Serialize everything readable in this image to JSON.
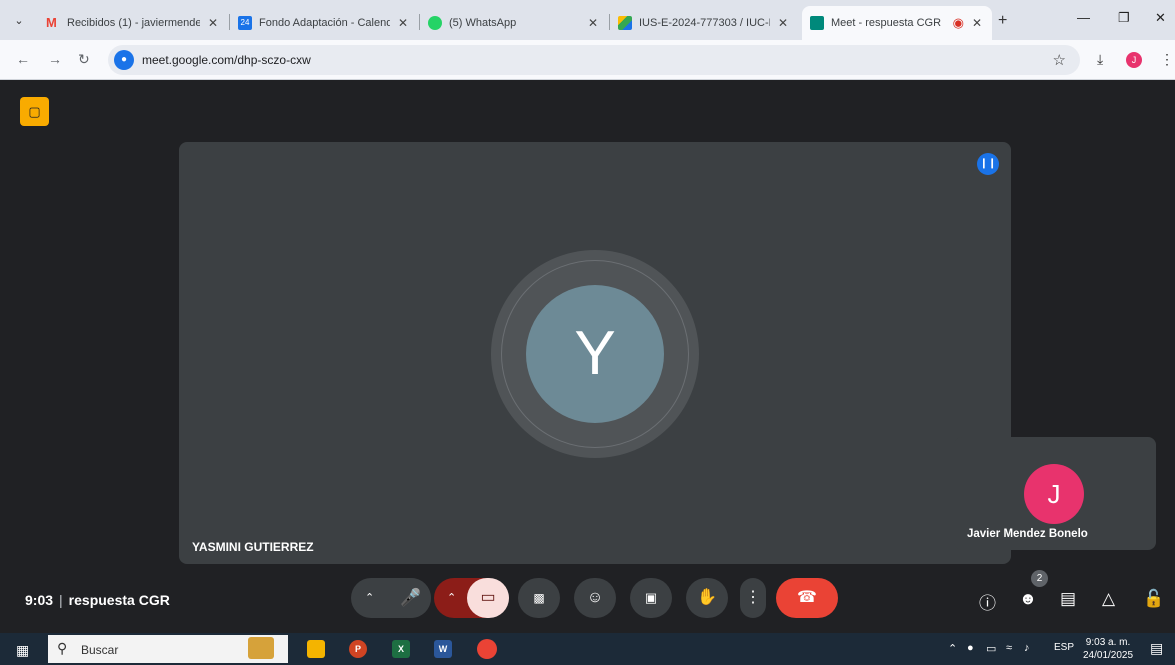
{
  "browser": {
    "tabs": [
      {
        "label": "Recibidos (1) - javiermendez",
        "favicon": "gmail-icon",
        "color": "#ea4335"
      },
      {
        "label": "Fondo Adaptación - Calenda",
        "favicon": "calendar-icon",
        "color": "#1a73e8"
      },
      {
        "label": "(5) WhatsApp",
        "favicon": "whatsapp-icon",
        "color": "#25d366"
      },
      {
        "label": "IUS-E-2024-777303 / IUC-D",
        "favicon": "drive-icon",
        "color": "#fbbc04"
      },
      {
        "label": "Meet - respuesta CGR",
        "favicon": "meet-icon",
        "color": "#00897b",
        "active": true
      }
    ],
    "address": "meet.google.com/dhp-sczo-cxw",
    "profile_initial": "J"
  },
  "meet": {
    "main_participant": {
      "initial": "Y",
      "name": "YASMINI GUTIERREZ"
    },
    "self_participant": {
      "initial": "J",
      "name": "Javier Mendez Bonelo"
    },
    "clock": "9:03",
    "meeting_title": "respuesta CGR",
    "people_count": "2"
  },
  "taskbar": {
    "search_placeholder": "Buscar",
    "language": "ESP",
    "time": "9:03 a. m.",
    "date": "24/01/2025"
  }
}
